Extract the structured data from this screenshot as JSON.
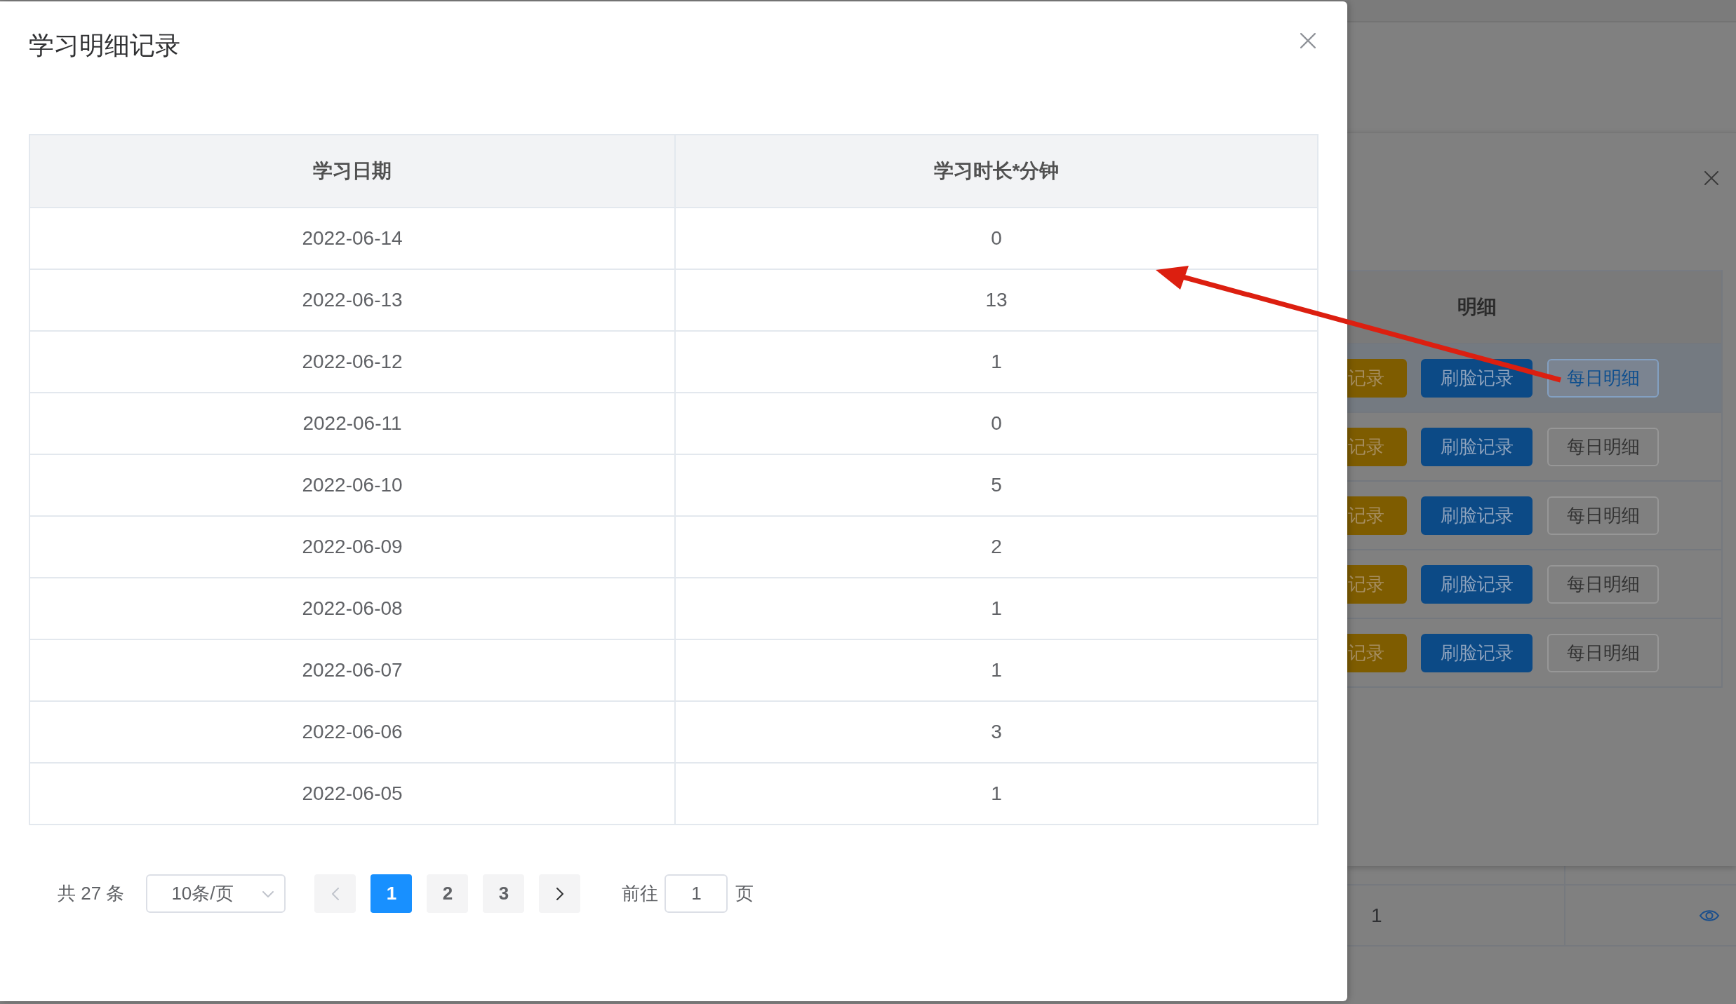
{
  "dialog": {
    "title": "学习明细记录",
    "table": {
      "columns": [
        "学习日期",
        "学习时长*分钟"
      ],
      "rows": [
        [
          "2022-06-14",
          "0"
        ],
        [
          "2022-06-13",
          "13"
        ],
        [
          "2022-06-12",
          "1"
        ],
        [
          "2022-06-11",
          "0"
        ],
        [
          "2022-06-10",
          "5"
        ],
        [
          "2022-06-09",
          "2"
        ],
        [
          "2022-06-08",
          "1"
        ],
        [
          "2022-06-07",
          "1"
        ],
        [
          "2022-06-06",
          "3"
        ],
        [
          "2022-06-05",
          "1"
        ]
      ]
    },
    "pagination": {
      "total": "共 27 条",
      "page_size": "10条/页",
      "prev": {
        "disabled": true
      },
      "pages": [
        {
          "label": "1",
          "selected": true
        },
        {
          "label": "2",
          "selected": false
        },
        {
          "label": "3",
          "selected": false
        }
      ],
      "next": {
        "disabled": false
      },
      "goto_label": "前往",
      "goto_value": "1",
      "goto_suffix": "页"
    }
  },
  "background": {
    "dialog": {
      "table": {
        "columns": [
          "明细"
        ],
        "rows": [
          {
            "hovered": true,
            "buttons": [
              {
                "kind": "warning",
                "label": "记录",
                "hovered": false
              },
              {
                "kind": "primary",
                "label": "刷脸记录",
                "hovered": false
              },
              {
                "kind": "default",
                "label": "每日明细",
                "hovered": true
              }
            ]
          },
          {
            "hovered": false,
            "buttons": [
              {
                "kind": "warning",
                "label": "记录",
                "hovered": false
              },
              {
                "kind": "primary",
                "label": "刷脸记录",
                "hovered": false
              },
              {
                "kind": "default",
                "label": "每日明细",
                "hovered": false
              }
            ]
          },
          {
            "hovered": false,
            "buttons": [
              {
                "kind": "warning",
                "label": "记录",
                "hovered": false
              },
              {
                "kind": "primary",
                "label": "刷脸记录",
                "hovered": false
              },
              {
                "kind": "default",
                "label": "每日明细",
                "hovered": false
              }
            ]
          },
          {
            "hovered": false,
            "buttons": [
              {
                "kind": "warning",
                "label": "记录",
                "hovered": false
              },
              {
                "kind": "primary",
                "label": "刷脸记录",
                "hovered": false
              },
              {
                "kind": "default",
                "label": "每日明细",
                "hovered": false
              }
            ]
          },
          {
            "hovered": false,
            "buttons": [
              {
                "kind": "warning",
                "label": "记录",
                "hovered": false
              },
              {
                "kind": "primary",
                "label": "刷脸记录",
                "hovered": false
              },
              {
                "kind": "default",
                "label": "每日明细",
                "hovered": false
              }
            ]
          }
        ]
      }
    },
    "table": {
      "rows": [
        [
          "1"
        ]
      ]
    }
  }
}
